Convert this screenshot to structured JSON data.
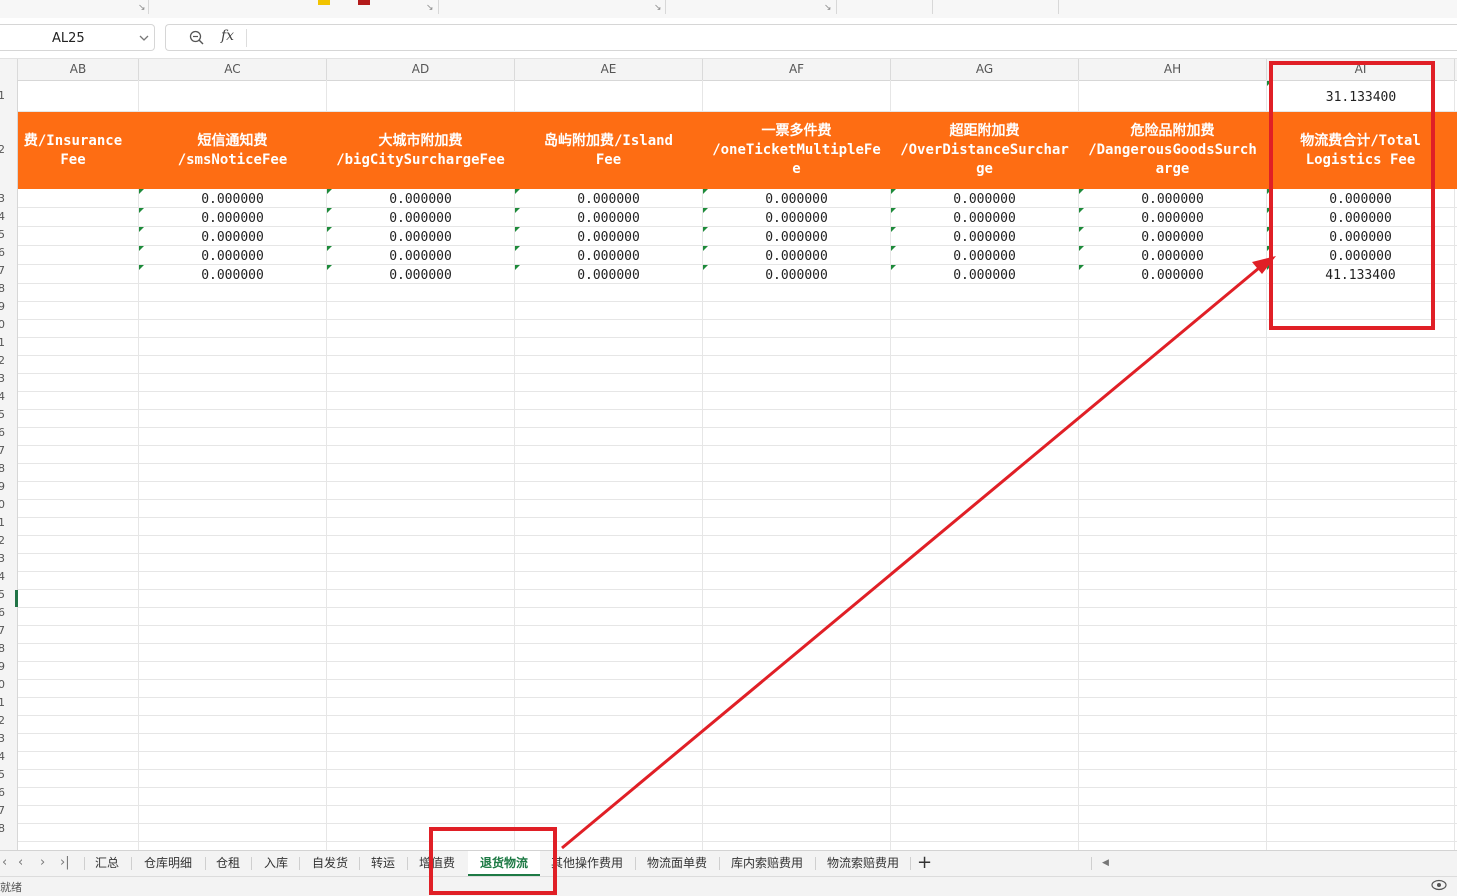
{
  "name_box": {
    "value": "AL25"
  },
  "formula_bar": {
    "fx_label": "fx",
    "content": ""
  },
  "columns": [
    "AB",
    "AC",
    "AD",
    "AE",
    "AF",
    "AG",
    "AH",
    "AI"
  ],
  "row_numbers": [
    "1",
    "2",
    "3",
    "4",
    "5",
    "6",
    "7",
    "8",
    "9",
    "0",
    "1",
    "2",
    "3",
    "4",
    "5",
    "6",
    "7",
    "8",
    "9",
    "0",
    "1",
    "2",
    "3",
    "4",
    "5",
    "6",
    "7",
    "8",
    "9",
    "0",
    "1",
    "2",
    "3",
    "4",
    "5",
    "6",
    "7",
    "8"
  ],
  "sheet": {
    "row1_ai_value": "31.133400",
    "headers": [
      {
        "col": "AB",
        "lines": [
          "费/Insurance",
          "Fee"
        ]
      },
      {
        "col": "AC",
        "lines": [
          "短信通知费",
          "/smsNoticeFee"
        ]
      },
      {
        "col": "AD",
        "lines": [
          "大城市附加费",
          "/bigCitySurchargeFee"
        ]
      },
      {
        "col": "AE",
        "lines": [
          "岛屿附加费/Island",
          "Fee"
        ]
      },
      {
        "col": "AF",
        "lines": [
          "一票多件费",
          "/oneTicketMultipleFe",
          "e"
        ]
      },
      {
        "col": "AG",
        "lines": [
          "超距附加费",
          "/OverDistanceSurchar",
          "ge"
        ]
      },
      {
        "col": "AH",
        "lines": [
          "危险品附加费",
          "/DangerousGoodsSurch",
          "arge"
        ]
      },
      {
        "col": "AI",
        "lines": [
          "物流费合计/Total",
          "Logistics Fee"
        ]
      }
    ],
    "data_rows": [
      [
        "0.000000",
        "0.000000",
        "0.000000",
        "0.000000",
        "0.000000",
        "0.000000",
        "0.000000"
      ],
      [
        "0.000000",
        "0.000000",
        "0.000000",
        "0.000000",
        "0.000000",
        "0.000000",
        "0.000000"
      ],
      [
        "0.000000",
        "0.000000",
        "0.000000",
        "0.000000",
        "0.000000",
        "0.000000",
        "0.000000"
      ],
      [
        "0.000000",
        "0.000000",
        "0.000000",
        "0.000000",
        "0.000000",
        "0.000000",
        "0.000000"
      ],
      [
        "0.000000",
        "0.000000",
        "0.000000",
        "0.000000",
        "0.000000",
        "0.000000",
        "41.133400"
      ]
    ]
  },
  "tabs": [
    "汇总",
    "仓库明细",
    "仓租",
    "入库",
    "自发货",
    "转运",
    "增值费",
    "退货物流",
    "其他操作费用",
    "物流面单费",
    "库内索赔费用",
    "物流索赔费用"
  ],
  "active_tab": "退货物流",
  "status_bar": {
    "left_label": "就绪"
  },
  "colors": {
    "header_orange": "#fe6d13",
    "annotation_red": "#e01f26",
    "active_tab_green": "#1e7a45"
  }
}
